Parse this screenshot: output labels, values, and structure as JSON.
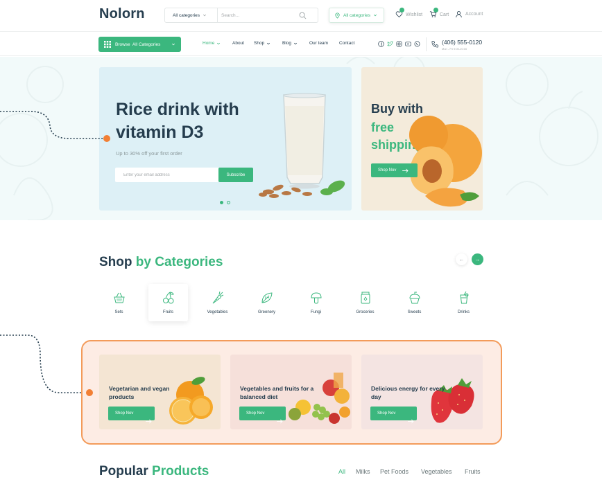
{
  "header": {
    "logo": "Nolorn",
    "search": {
      "category": "All categories",
      "placeholder": "Search..."
    },
    "location": "All categories",
    "actions": {
      "wishlist": "Wishlist",
      "cart": "Cart",
      "account": "Account"
    }
  },
  "nav": {
    "browse": "Browse  All Categories",
    "items": [
      "Home",
      "About",
      "Shop",
      "Blog",
      "Our team",
      "Contact"
    ],
    "phone": "(406) 555-0120",
    "phone_sub": "Mon - Fri 9:00-20:00"
  },
  "hero": {
    "title": "Rice drink with vitamin D3",
    "subtitle": "Up to 30% off your first order",
    "email_placeholder": "Enter your email address",
    "subscribe": "Subscribe"
  },
  "side_banner": {
    "line1": "Buy with",
    "line2": "free shipping",
    "button": "Shop Nov"
  },
  "categories": {
    "title_plain": "Shop",
    "title_highlight": "by Categories",
    "prev_arrow": "←",
    "next_arrow": "→",
    "items": [
      {
        "label": "Sets",
        "icon": "basket-icon",
        "bg": "#e5f3eb"
      },
      {
        "label": "Fruits",
        "icon": "cherry-icon",
        "bg": "#ffffff"
      },
      {
        "label": "Vegetables",
        "icon": "carrot-icon",
        "bg": "#f8ecec"
      },
      {
        "label": "Greenery",
        "icon": "leaf-icon",
        "bg": "#e0f1f6"
      },
      {
        "label": "Fungi",
        "icon": "mushroom-icon",
        "bg": "#f4ede0"
      },
      {
        "label": "Groceries",
        "icon": "jar-icon",
        "bg": "#f5ecec"
      },
      {
        "label": "Sweets",
        "icon": "cupcake-icon",
        "bg": "#e2f2e7"
      },
      {
        "label": "Drinks",
        "icon": "drink-icon",
        "bg": "#edf0f6"
      }
    ]
  },
  "promos": [
    {
      "title": "Vegetarian and vegan products",
      "button": "Shop Nov",
      "bg": "#f4e5d3"
    },
    {
      "title": "Vegetables and fruits for a balanced diet",
      "button": "Shop Nov",
      "bg": "#f6e0da"
    },
    {
      "title": "Delicious energy for every day",
      "button": "Shop Nov",
      "bg": "#f4e4e2"
    }
  ],
  "popular": {
    "title_plain": "Popular",
    "title_highlight": "Products",
    "tabs": [
      "All",
      "Milks",
      "Pet Foods",
      "Vegetables",
      "Fruits"
    ]
  },
  "colors": {
    "accent": "#3bb77e",
    "dark": "#253d4e",
    "callout": "#f27f34"
  }
}
